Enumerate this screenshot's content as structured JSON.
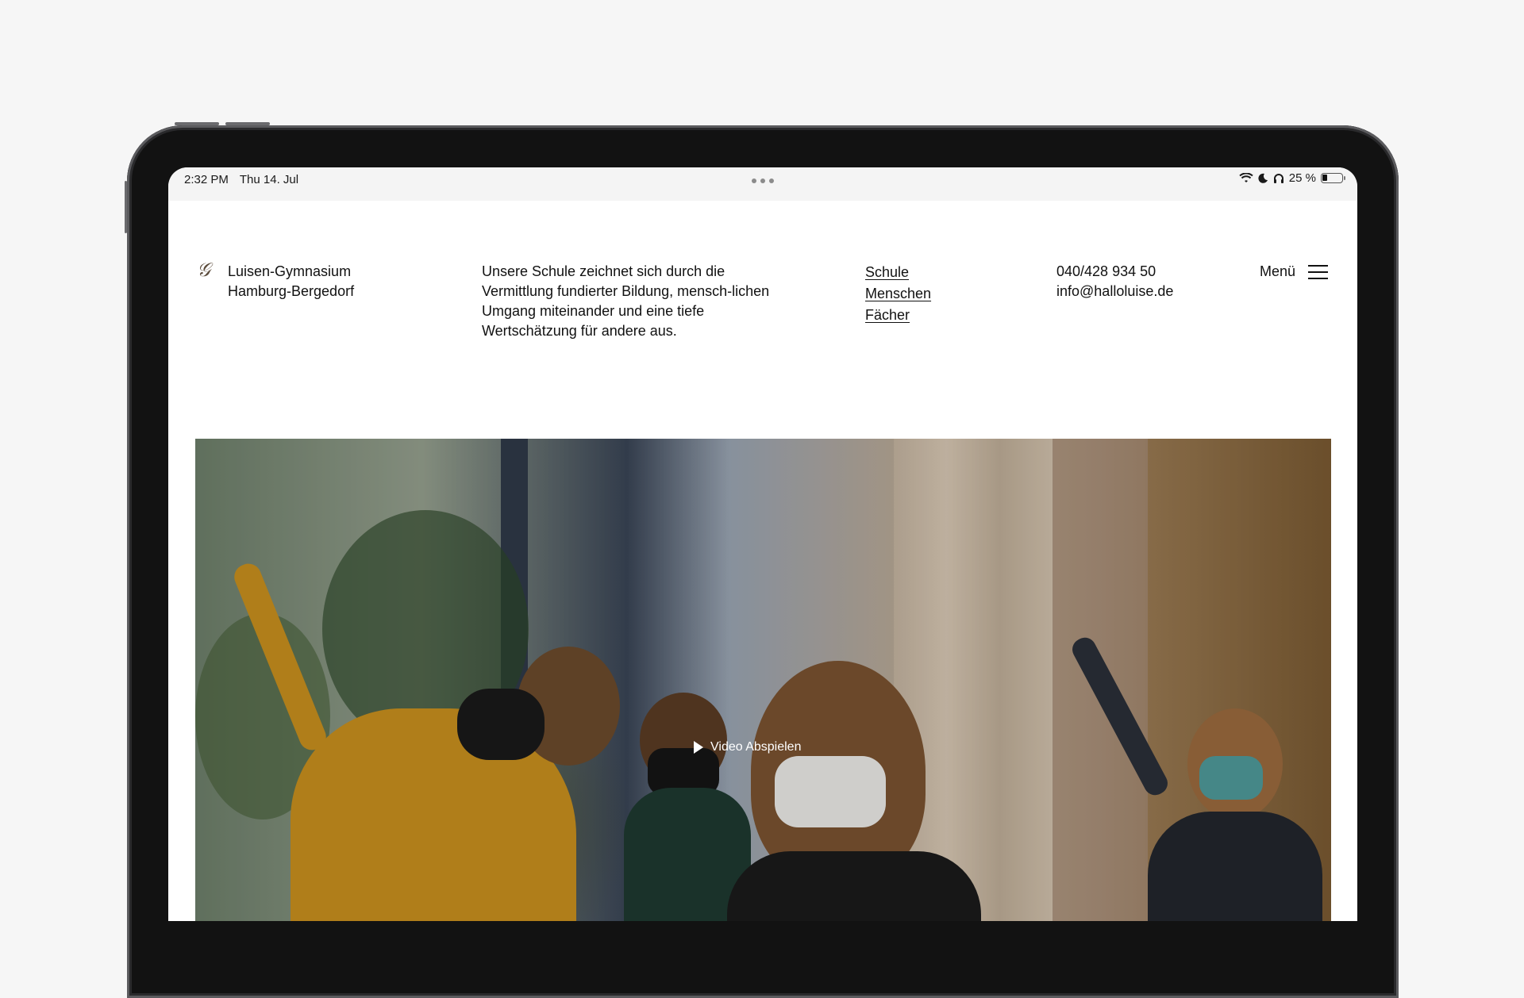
{
  "statusbar": {
    "time": "2:32 PM",
    "date": "Thu 14. Jul",
    "battery_text": "25 %",
    "battery_level": 0.25,
    "icons": [
      "wifi-icon",
      "moon-icon",
      "headphones-icon",
      "battery-icon"
    ]
  },
  "header": {
    "logo_glyph": "𝒢",
    "school_line1": "Luisen-Gymnasium",
    "school_line2": "Hamburg-Bergedorf",
    "tagline": "Unsere Schule zeichnet sich durch die Vermittlung fundierter Bildung, mensch-lichen Umgang miteinander und eine tiefe Wertschätzung für andere aus.",
    "nav": [
      "Schule",
      "Menschen",
      "Fächer"
    ],
    "phone": "040/428 934 50",
    "email": "info@halloluise.de",
    "menu_label": "Menü"
  },
  "hero": {
    "play_label": "Video Abspielen"
  },
  "colors": {
    "page_bg": "#f6f6f6",
    "device_frame": "#121212",
    "screen_bg": "#ffffff",
    "text": "#111111"
  }
}
